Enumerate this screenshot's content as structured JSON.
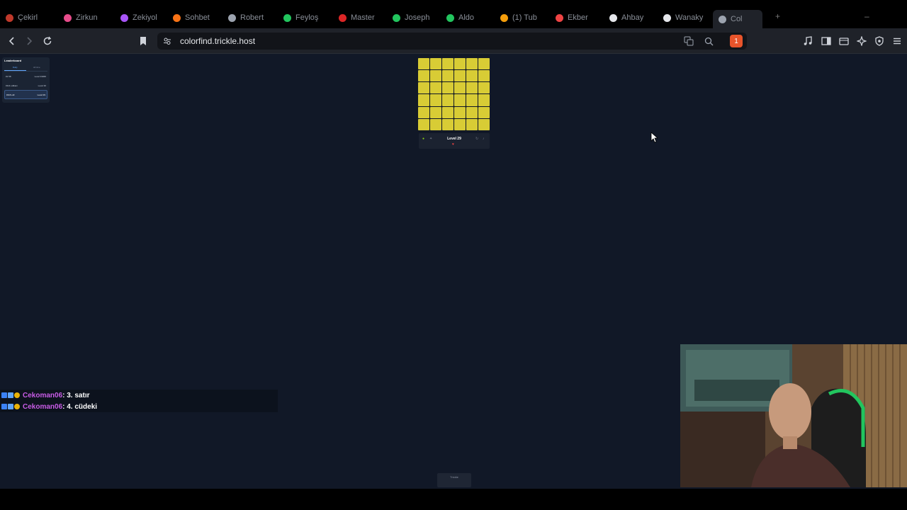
{
  "browser": {
    "tabs": [
      {
        "label": "Çekirl",
        "color": "#c0392b"
      },
      {
        "label": "Zirkun",
        "color": "#e74c8b"
      },
      {
        "label": "Zekiyol",
        "color": "#a855f7"
      },
      {
        "label": "Sohbet",
        "color": "#f97316"
      },
      {
        "label": "Robert",
        "color": "#9ca3af"
      },
      {
        "label": "Feyloş",
        "color": "#22c55e"
      },
      {
        "label": "Master",
        "color": "#dc2626"
      },
      {
        "label": "Joseph",
        "color": "#22c55e"
      },
      {
        "label": "Aldo",
        "color": "#22c55e"
      },
      {
        "label": "(1) Tub",
        "color": "#f59e0b"
      },
      {
        "label": "Ekber",
        "color": "#ef4444"
      },
      {
        "label": "Ahbay",
        "color": "#e5e7eb"
      },
      {
        "label": "Wanaky",
        "color": "#e5e7eb"
      },
      {
        "label": "Col",
        "color": "#9ca3af"
      }
    ],
    "url": "colorfind.trickle.host",
    "shield_count": "1"
  },
  "leaderboard": {
    "title": "Leaderboard",
    "tabs": [
      "Daily",
      "All time"
    ],
    "rows": [
      {
        "name": "#1 58",
        "value": "Level 33066"
      },
      {
        "name": "#114 odlkam",
        "value": "Level 30"
      },
      {
        "name": "#116 odl",
        "value": "Level 29"
      }
    ]
  },
  "game": {
    "level_label": "Level 29",
    "grid_rows": 6,
    "grid_cols": 6,
    "tile_color": "#d8cc35"
  },
  "chat": [
    {
      "user": "Cekoman06",
      "message": ": 3. satır"
    },
    {
      "user": "Cekoman06",
      "message": ": 4. cüdeki"
    }
  ],
  "footer_badge": "Trickle"
}
